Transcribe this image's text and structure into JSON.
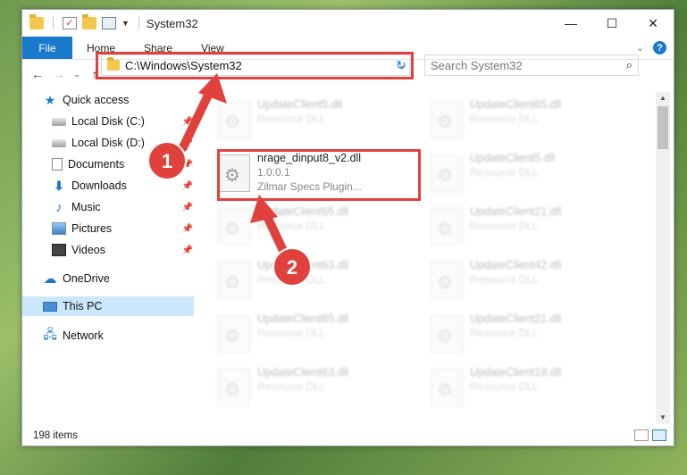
{
  "window": {
    "title": "System32",
    "controls": {
      "minimize": "—",
      "maximize": "☐",
      "close": "✕"
    }
  },
  "ribbon": {
    "tabs": [
      "File",
      "Home",
      "Share",
      "View"
    ],
    "help": "?"
  },
  "nav": {
    "address": "C:\\Windows\\System32",
    "search_placeholder": "Search System32"
  },
  "sidebar": {
    "items": [
      {
        "label": "Quick access",
        "icon": "star-icon"
      },
      {
        "label": "Local Disk (C:)",
        "icon": "disk-icon",
        "pinned": true
      },
      {
        "label": "Local Disk (D:)",
        "icon": "disk-icon",
        "pinned": true
      },
      {
        "label": "Documents",
        "icon": "documents-icon",
        "pinned": true
      },
      {
        "label": "Downloads",
        "icon": "downloads-icon",
        "pinned": true
      },
      {
        "label": "Music",
        "icon": "music-icon",
        "pinned": true
      },
      {
        "label": "Pictures",
        "icon": "pictures-icon",
        "pinned": true
      },
      {
        "label": "Videos",
        "icon": "videos-icon",
        "pinned": true
      },
      {
        "label": "OneDrive",
        "icon": "cloud-icon"
      },
      {
        "label": "This PC",
        "icon": "pc-icon",
        "selected": true
      },
      {
        "label": "Network",
        "icon": "network-icon"
      }
    ]
  },
  "files": {
    "highlighted": {
      "name": "nrage_dinput8_v2.dll",
      "version": "1.0.0.1",
      "desc": "Zilmar Specs Plugin..."
    },
    "left": [
      {
        "name": "UpdateClient5.dll",
        "desc": "Resource DLL"
      },
      {
        "name": "UpdateClient65.dll",
        "desc": "Resource DLL"
      },
      {
        "name": "UpdateClient63.dll",
        "desc": "Resource DLL"
      },
      {
        "name": "UpdateClient65.dll",
        "desc": "Resource DLL"
      },
      {
        "name": "UpdateClient63.dll",
        "desc": "Resource DLL"
      }
    ],
    "right": [
      {
        "name": "UpdateClient65.dll",
        "desc": "Resource DLL"
      },
      {
        "name": "UpdateClient5.dll",
        "desc": "Resource DLL"
      },
      {
        "name": "UpdateClient21.dll",
        "desc": "Resource DLL"
      },
      {
        "name": "UpdateClient42.dll",
        "desc": "Resource DLL"
      },
      {
        "name": "UpdateClient21.dll",
        "desc": "Resource DLL"
      },
      {
        "name": "UpdateClient19.dll",
        "desc": "Resource DLL"
      }
    ]
  },
  "status": {
    "count": "198 items"
  },
  "annotations": {
    "badge1": "1",
    "badge2": "2",
    "color": "#e0413d"
  }
}
